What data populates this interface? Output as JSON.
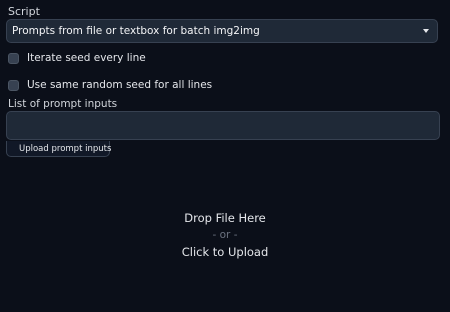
{
  "script": {
    "label": "Script",
    "selected": "Prompts from file or textbox for batch img2img"
  },
  "options": {
    "iterate_seed": {
      "label": "Iterate seed every line",
      "checked": false
    },
    "same_seed": {
      "label": "Use same random seed for all lines",
      "checked": false
    }
  },
  "prompt_inputs": {
    "label": "List of prompt inputs",
    "value": "",
    "upload_tab_label": "Upload prompt inputs"
  },
  "dropzone": {
    "drop_text": "Drop File Here",
    "or_text": "- or -",
    "click_text": "Click to Upload"
  },
  "colors": {
    "background": "#0b0f19",
    "input_bg": "#1f2937",
    "border": "#374151",
    "text": "#e5e7eb",
    "muted": "#6b7280"
  },
  "icons": {
    "select_caret": "chevron-down-icon",
    "upload_tab": "file-icon"
  }
}
